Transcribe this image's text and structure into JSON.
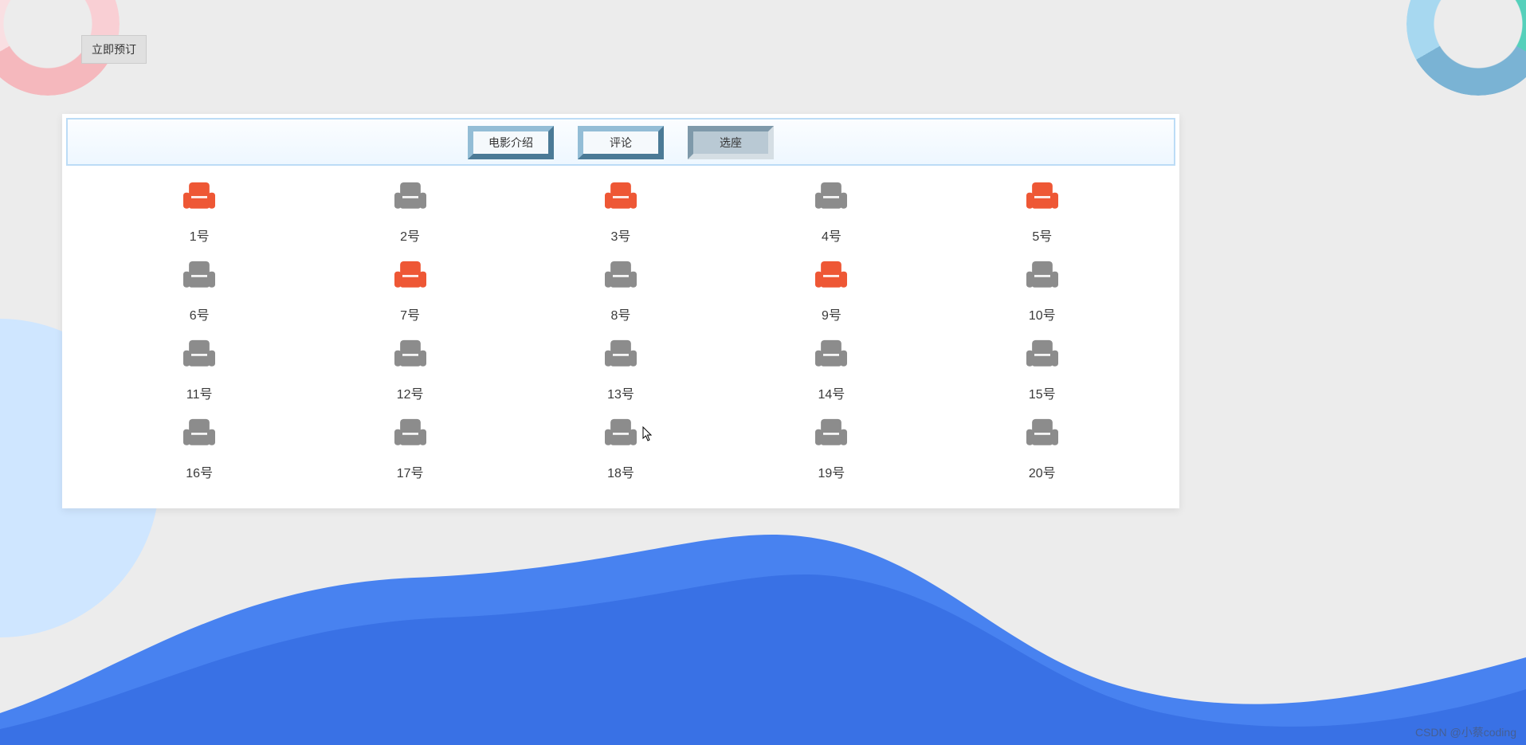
{
  "colors": {
    "seat_available": "#8c8c8c",
    "seat_taken": "#ee5735",
    "tab_border_light": "#93bdd6",
    "tab_border_dark": "#4b7a96"
  },
  "book_button": {
    "label": "立即预订"
  },
  "tabs": [
    {
      "id": "intro",
      "label": "电影介绍",
      "active": false
    },
    {
      "id": "comment",
      "label": "评论",
      "active": false
    },
    {
      "id": "seat",
      "label": "选座",
      "active": true
    }
  ],
  "seats": [
    {
      "num": 1,
      "label": "1号",
      "taken": true
    },
    {
      "num": 2,
      "label": "2号",
      "taken": false
    },
    {
      "num": 3,
      "label": "3号",
      "taken": true
    },
    {
      "num": 4,
      "label": "4号",
      "taken": false
    },
    {
      "num": 5,
      "label": "5号",
      "taken": true
    },
    {
      "num": 6,
      "label": "6号",
      "taken": false
    },
    {
      "num": 7,
      "label": "7号",
      "taken": true
    },
    {
      "num": 8,
      "label": "8号",
      "taken": false
    },
    {
      "num": 9,
      "label": "9号",
      "taken": true
    },
    {
      "num": 10,
      "label": "10号",
      "taken": false
    },
    {
      "num": 11,
      "label": "11号",
      "taken": false
    },
    {
      "num": 12,
      "label": "12号",
      "taken": false
    },
    {
      "num": 13,
      "label": "13号",
      "taken": false
    },
    {
      "num": 14,
      "label": "14号",
      "taken": false
    },
    {
      "num": 15,
      "label": "15号",
      "taken": false
    },
    {
      "num": 16,
      "label": "16号",
      "taken": false
    },
    {
      "num": 17,
      "label": "17号",
      "taken": false
    },
    {
      "num": 18,
      "label": "18号",
      "taken": false
    },
    {
      "num": 19,
      "label": "19号",
      "taken": false
    },
    {
      "num": 20,
      "label": "20号",
      "taken": false
    }
  ],
  "watermark": "CSDN @小蔡coding"
}
